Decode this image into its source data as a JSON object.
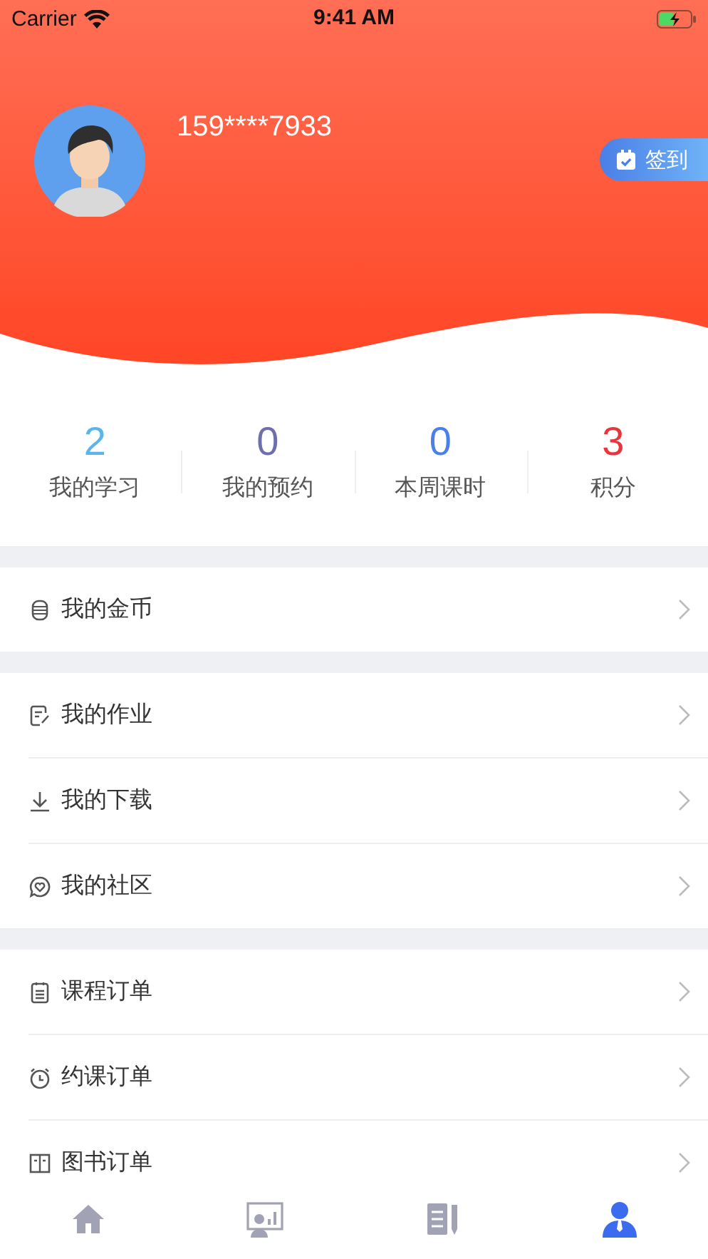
{
  "status_bar": {
    "carrier": "Carrier",
    "time": "9:41 AM"
  },
  "profile": {
    "phone": "159****7933",
    "checkin_button": "签到"
  },
  "stats": [
    {
      "value": "2",
      "label": "我的学习",
      "color": "#5ab4ee"
    },
    {
      "value": "0",
      "label": "我的预约",
      "color": "#6f6fae"
    },
    {
      "value": "0",
      "label": "本周课时",
      "color": "#4a80e8"
    },
    {
      "value": "3",
      "label": "积分",
      "color": "#e8343c"
    }
  ],
  "menu_groups": [
    {
      "items": [
        {
          "label": "我的金币"
        }
      ]
    },
    {
      "items": [
        {
          "label": "我的作业"
        },
        {
          "label": "我的下载"
        },
        {
          "label": "我的社区"
        }
      ]
    },
    {
      "items": [
        {
          "label": "课程订单"
        },
        {
          "label": "约课订单"
        },
        {
          "label": "图书订单"
        }
      ]
    }
  ],
  "tab_bar": [
    {
      "selected": false
    },
    {
      "selected": false
    },
    {
      "selected": false
    },
    {
      "selected": true
    }
  ]
}
